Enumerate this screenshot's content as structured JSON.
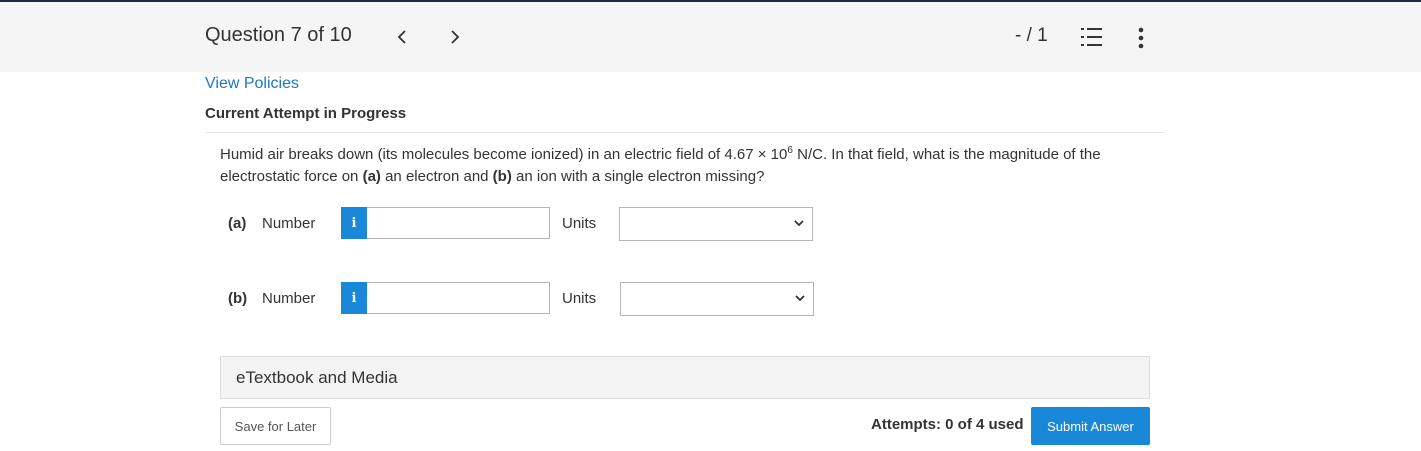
{
  "header": {
    "question_counter": "Question 7 of 10",
    "prev_symbol": "<",
    "next_symbol": ">",
    "score": "- / 1"
  },
  "links": {
    "view_policies": "View Policies"
  },
  "attempt_heading": "Current Attempt in Progress",
  "question": {
    "text_1": "Humid air breaks down (its molecules become ionized) in an electric field of 4.67 × 10",
    "exponent": "6",
    "text_2": " N/C. In that field, what is the magnitude of the electrostatic force on ",
    "part_a_marker": "(a)",
    "text_3": " an electron and ",
    "part_b_marker": "(b)",
    "text_4": " an ion with a single electron missing?"
  },
  "answers": [
    {
      "part": "(a)",
      "number_label": "Number",
      "info_symbol": "i",
      "value": "",
      "units_label": "Units",
      "units_selected": ""
    },
    {
      "part": "(b)",
      "number_label": "Number",
      "info_symbol": "i",
      "value": "",
      "units_label": "Units",
      "units_selected": ""
    }
  ],
  "etextbook_label": "eTextbook and Media",
  "footer": {
    "save_label": "Save for Later",
    "attempts": "Attempts: 0 of 4 used",
    "submit_label": "Submit Answer"
  },
  "colors": {
    "accent": "#1a88d8",
    "link": "#1a7ac4",
    "header_bg": "#f5f5f5"
  }
}
